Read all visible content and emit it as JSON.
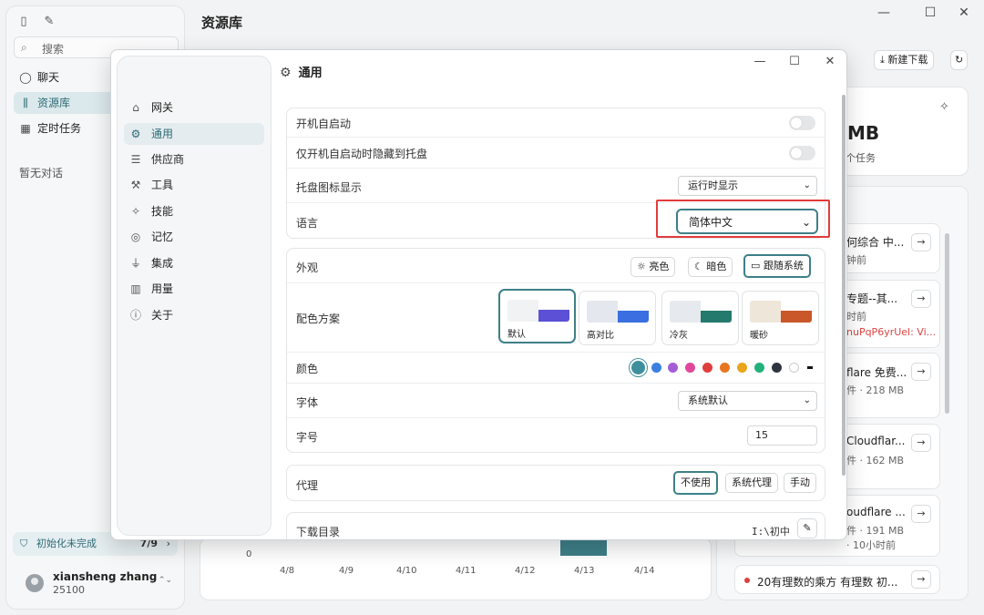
{
  "app": {
    "page_title": "资源库",
    "sidebar": {
      "search_placeholder": "搜索",
      "items": [
        {
          "label": "聊天",
          "icon": "chat-icon"
        },
        {
          "label": "资源库",
          "icon": "library-icon"
        },
        {
          "label": "定时任务",
          "icon": "calendar-icon"
        }
      ],
      "empty_text": "暂无对话",
      "init_status": {
        "label": "初始化未完成",
        "count": "7/9"
      },
      "user": {
        "name": "xiansheng zhang",
        "id": "25100"
      }
    },
    "toolbar": {
      "new_download": "新建下载"
    },
    "stats": {
      "size_fragment": "MB",
      "tasks_fragment": "个任务"
    },
    "list": [
      {
        "title": "何综合 中...",
        "sub": "钟前",
        "sub2": ""
      },
      {
        "title": "专题--其...",
        "sub": "时前",
        "sub2": "nuPqP6yrUel: Vi..."
      },
      {
        "title": "flare 免费...",
        "sub": "件 · 218 MB",
        "sub2": ""
      },
      {
        "title": "Cloudflar...",
        "sub": "件 · 162 MB",
        "sub2": ""
      },
      {
        "title": "oudflare ...",
        "sub": "件 · 191 MB",
        "sub2": "· 10小时前"
      },
      {
        "title": "20有理数的乘方 有理数 初...",
        "sub": "",
        "sub2": ""
      }
    ],
    "chart_axis": {
      "zero": "0",
      "dates": [
        "4/8",
        "4/9",
        "4/10",
        "4/11",
        "4/12",
        "4/13",
        "4/14"
      ]
    }
  },
  "dialog": {
    "title": "通用",
    "nav": [
      {
        "label": "网关",
        "icon": "gateway-icon"
      },
      {
        "label": "通用",
        "icon": "gear-icon"
      },
      {
        "label": "供应商",
        "icon": "server-icon"
      },
      {
        "label": "工具",
        "icon": "wrench-icon"
      },
      {
        "label": "技能",
        "icon": "sparkle-icon"
      },
      {
        "label": "记忆",
        "icon": "brain-icon"
      },
      {
        "label": "集成",
        "icon": "plug-icon"
      },
      {
        "label": "用量",
        "icon": "bar-chart-icon"
      },
      {
        "label": "关于",
        "icon": "info-icon"
      }
    ],
    "settings": {
      "autostart": "开机自启动",
      "hide_to_tray": "仅开机自启动时隐藏到托盘",
      "tray_icon": {
        "label": "托盘图标显示",
        "value": "运行时显示"
      },
      "language": {
        "label": "语言",
        "value": "简体中文"
      },
      "appearance": {
        "label": "外观",
        "options": [
          "亮色",
          "暗色",
          "跟随系统"
        ],
        "selected": "跟随系统"
      },
      "color_scheme": {
        "label": "配色方案",
        "options": [
          {
            "name": "默认",
            "left": "#f1f2f4",
            "right": "#5b50d6"
          },
          {
            "name": "高对比",
            "left": "#e4e8ee",
            "right": "#3b6ee0"
          },
          {
            "name": "冷灰",
            "left": "#e6eaee",
            "right": "#247a6d"
          },
          {
            "name": "暖砂",
            "left": "#efe6da",
            "right": "#c9572a"
          }
        ],
        "selected": "默认"
      },
      "color": {
        "label": "颜色",
        "swatches": [
          "#3e8f9c",
          "#3b7fe0",
          "#a35ed6",
          "#e0479a",
          "#e03e3e",
          "#e8761e",
          "#e9a61b",
          "#22b17a",
          "#2f3540",
          "#ffffff",
          "#111111"
        ]
      },
      "font": {
        "label": "字体",
        "value": "系统默认"
      },
      "font_size": {
        "label": "字号",
        "value": "15"
      },
      "proxy": {
        "label": "代理",
        "options": [
          "不使用",
          "系统代理",
          "手动"
        ],
        "selected": "不使用"
      },
      "download_dir": {
        "label": "下载目录",
        "value": "I:\\初中"
      }
    }
  }
}
